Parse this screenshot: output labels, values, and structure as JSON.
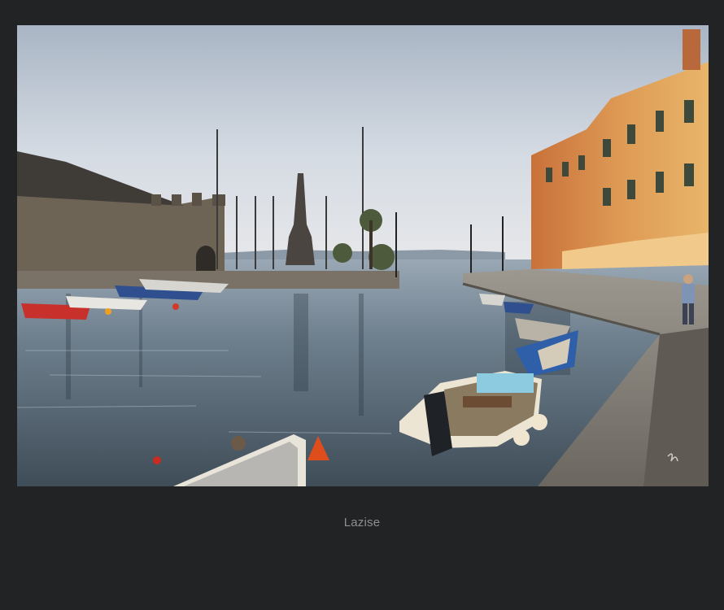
{
  "page": {
    "background": "#222324"
  },
  "photo": {
    "subject": "harbor-scene",
    "colors": {
      "sky": "#c9d2dc",
      "water": "#5c6c7a",
      "fortress": "#6e6456",
      "buildings": "#d78a4a",
      "quay": "#8d8a85"
    }
  },
  "caption": {
    "text": "Lazise",
    "color": "#8f8f8f"
  }
}
